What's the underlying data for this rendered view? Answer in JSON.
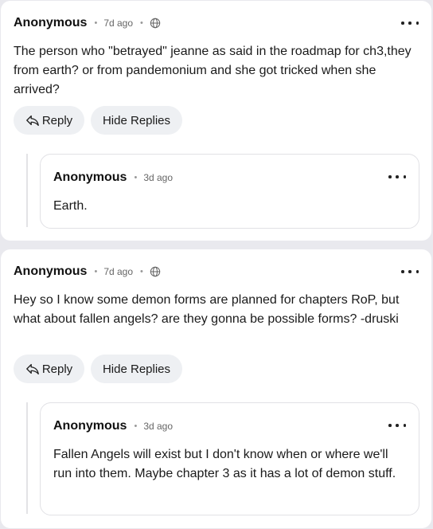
{
  "comments": [
    {
      "author": "Anonymous",
      "time": "7d ago",
      "text": "The person who \"betrayed\" jeanne as said in the roadmap for ch3,they from earth? or from pandemonium and she got tricked when she arrived?",
      "reply_label": "Reply",
      "hide_label": "Hide Replies",
      "replies": [
        {
          "author": "Anonymous",
          "time": "3d ago",
          "text": "Earth."
        }
      ]
    },
    {
      "author": "Anonymous",
      "time": "7d ago",
      "text": "Hey so I know some demon forms are planned for chapters RoP, but what about fallen angels? are they gonna be possible forms? -druski",
      "reply_label": "Reply",
      "hide_label": "Hide Replies",
      "replies": [
        {
          "author": "Anonymous",
          "time": "3d ago",
          "text": "Fallen Angels will exist but I don't know when or where we'll run into them. Maybe chapter 3 as it has a lot of demon stuff."
        }
      ]
    }
  ],
  "icons": {
    "visibility": "globe-icon",
    "reply": "reply-arrow-icon",
    "menu": "more-options-icon"
  }
}
